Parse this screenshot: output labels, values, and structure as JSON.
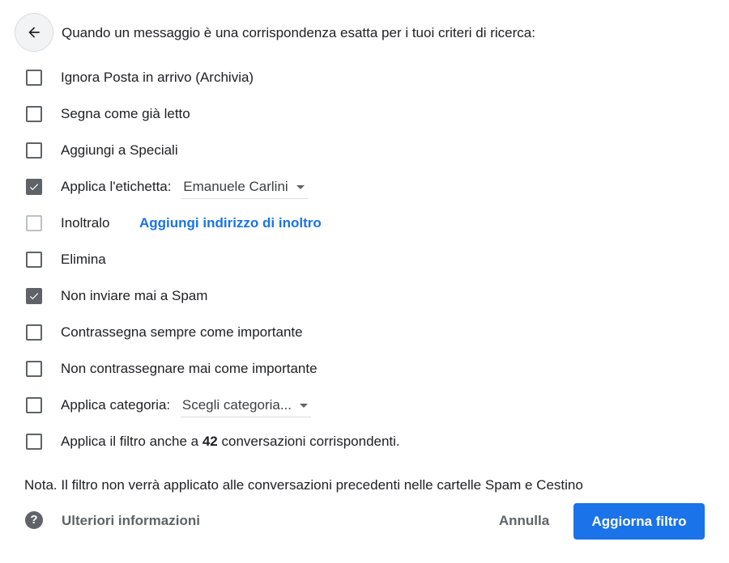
{
  "header": {
    "back_icon": "arrow-left-icon",
    "title": "Quando un messaggio è una corrispondenza esatta per i tuoi criteri di ricerca:"
  },
  "options": [
    {
      "label": "Ignora Posta in arrivo (Archivia)",
      "checked": false
    },
    {
      "label": "Segna come già letto",
      "checked": false
    },
    {
      "label": "Aggiungi a Speciali",
      "checked": false
    },
    {
      "label": "Applica l'etichetta:",
      "checked": true,
      "dropdown_value": "Emanuele Carlini"
    },
    {
      "label": "Inoltralo",
      "checked": false,
      "disabled": true,
      "link": "Aggiungi indirizzo di inoltro"
    },
    {
      "label": "Elimina",
      "checked": false
    },
    {
      "label": "Non inviare mai a Spam",
      "checked": true
    },
    {
      "label": "Contrassegna sempre come importante",
      "checked": false
    },
    {
      "label": "Non contrassegnare mai come importante",
      "checked": false
    },
    {
      "label": "Applica categoria:",
      "checked": false,
      "dropdown_value": "Scegli categoria..."
    },
    {
      "label_before": "Applica il filtro anche a",
      "count": "42",
      "label_after": "conversazioni corrispondenti.",
      "checked": false
    }
  ],
  "note": "Nota. Il filtro non verrà applicato alle conversazioni precedenti nelle cartelle Spam e Cestino",
  "footer": {
    "help_icon": "help-circle-icon",
    "more_info": "Ulteriori informazioni",
    "cancel": "Annulla",
    "submit": "Aggiorna filtro"
  },
  "colors": {
    "primary": "#1a73e8",
    "checkbox": "#5f6368"
  }
}
